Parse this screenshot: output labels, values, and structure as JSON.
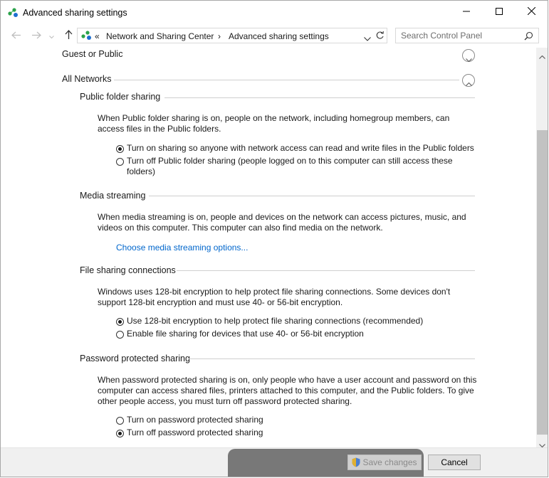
{
  "window": {
    "title": "Advanced sharing settings"
  },
  "nav": {
    "overflow": "«",
    "breadcrumb": [
      "Network and Sharing Center",
      "Advanced sharing settings"
    ],
    "search_placeholder": "Search Control Panel"
  },
  "profiles": {
    "guest_public": "Guest or Public",
    "all_networks": "All Networks"
  },
  "public_folder": {
    "heading": "Public folder sharing",
    "desc1": "When Public folder sharing is on, people on the network, including homegroup members, can",
    "desc2": "access files in the Public folders.",
    "opt_on": "Turn on sharing so anyone with network access can read and write files in the Public folders",
    "opt_off1": "Turn off Public folder sharing (people logged on to this computer can still access these",
    "opt_off2": "folders)",
    "selected": "on"
  },
  "media": {
    "heading": "Media streaming",
    "desc1": "When media streaming is on, people and devices on the network can access pictures, music, and",
    "desc2": "videos on this computer. This computer can also find media on the network.",
    "link": "Choose media streaming options..."
  },
  "file_sharing": {
    "heading": "File sharing connections",
    "desc1": "Windows uses 128-bit encryption to help protect file sharing connections. Some devices don't",
    "desc2": "support 128-bit encryption and must use 40- or 56-bit encryption.",
    "opt_128": "Use 128-bit encryption to help protect file sharing connections (recommended)",
    "opt_40": "Enable file sharing for devices that use 40- or 56-bit encryption",
    "selected": "128"
  },
  "password": {
    "heading": "Password protected sharing",
    "desc1": "When password protected sharing is on, only people who have a user account and password on this",
    "desc2": "computer can access shared files, printers attached to this computer, and the Public folders. To give",
    "desc3": "other people access, you must turn off password protected sharing.",
    "opt_on": "Turn on password protected sharing",
    "opt_off": "Turn off password protected sharing",
    "selected": "off"
  },
  "footer": {
    "save_label": "Save changes",
    "cancel_label": "Cancel"
  },
  "colors": {
    "link": "#0066cc",
    "brand_green": "#2aa24a",
    "brand_blue": "#1e6fd0"
  }
}
